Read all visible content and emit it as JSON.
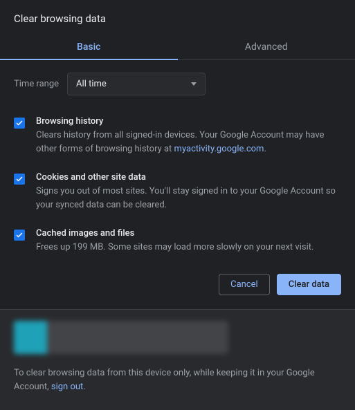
{
  "title": "Clear browsing data",
  "tabs": {
    "basic": "Basic",
    "advanced": "Advanced"
  },
  "timeRange": {
    "label": "Time range",
    "value": "All time"
  },
  "options": {
    "history": {
      "title": "Browsing history",
      "descPrefix": "Clears history from all signed-in devices. Your Google Account may have other forms of browsing history at ",
      "link": "myactivity.google.com",
      "descSuffix": "."
    },
    "cookies": {
      "title": "Cookies and other site data",
      "desc": "Signs you out of most sites. You'll stay signed in to your Google Account so your synced data can be cleared."
    },
    "cache": {
      "title": "Cached images and files",
      "desc": "Frees up 199 MB. Some sites may load more slowly on your next visit."
    }
  },
  "buttons": {
    "cancel": "Cancel",
    "clear": "Clear data"
  },
  "footer": {
    "textPrefix": "To clear browsing data from this device only, while keeping it in your Google Account, ",
    "link": "sign out",
    "textSuffix": "."
  }
}
